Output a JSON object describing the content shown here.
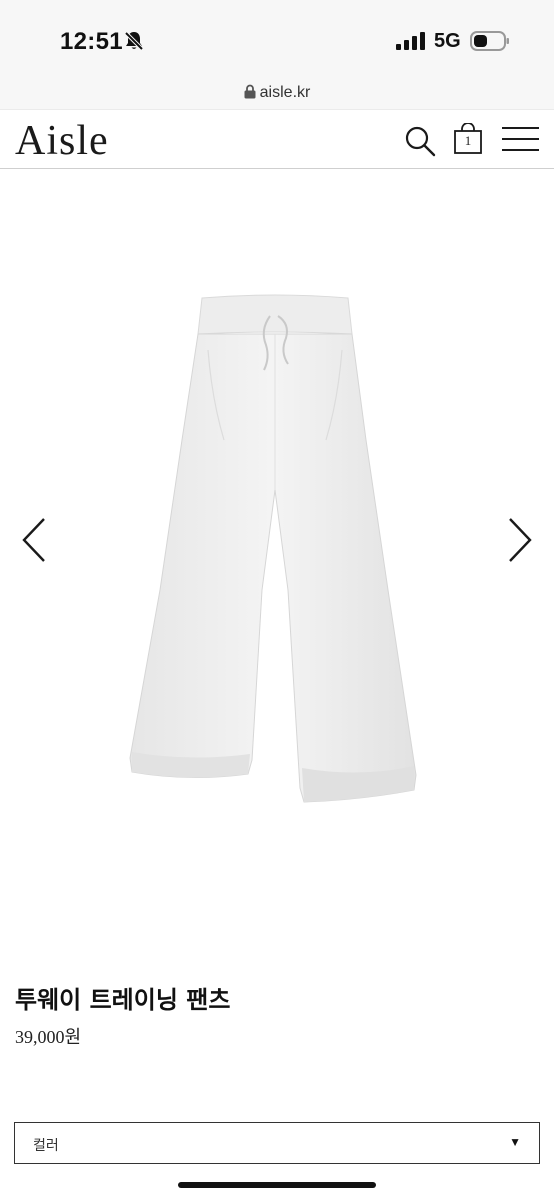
{
  "status_bar": {
    "time": "12:51",
    "network": "5G",
    "icons": [
      "bell-slash-icon",
      "signal-icon",
      "battery-icon"
    ]
  },
  "browser": {
    "url": "aisle.kr",
    "icon": "lock-icon"
  },
  "header": {
    "logo": "Aisle",
    "cart_count": "1",
    "icons": [
      "search-icon",
      "shopping-bag-icon",
      "hamburger-menu-icon"
    ]
  },
  "gallery": {
    "image": "white-training-pants",
    "prev_icon": "chevron-left-icon",
    "next_icon": "chevron-right-icon"
  },
  "product": {
    "name": "투웨이 트레이닝 팬츠",
    "price": "39,000원"
  },
  "options": {
    "color_label": "컬러",
    "caret": "▼"
  }
}
